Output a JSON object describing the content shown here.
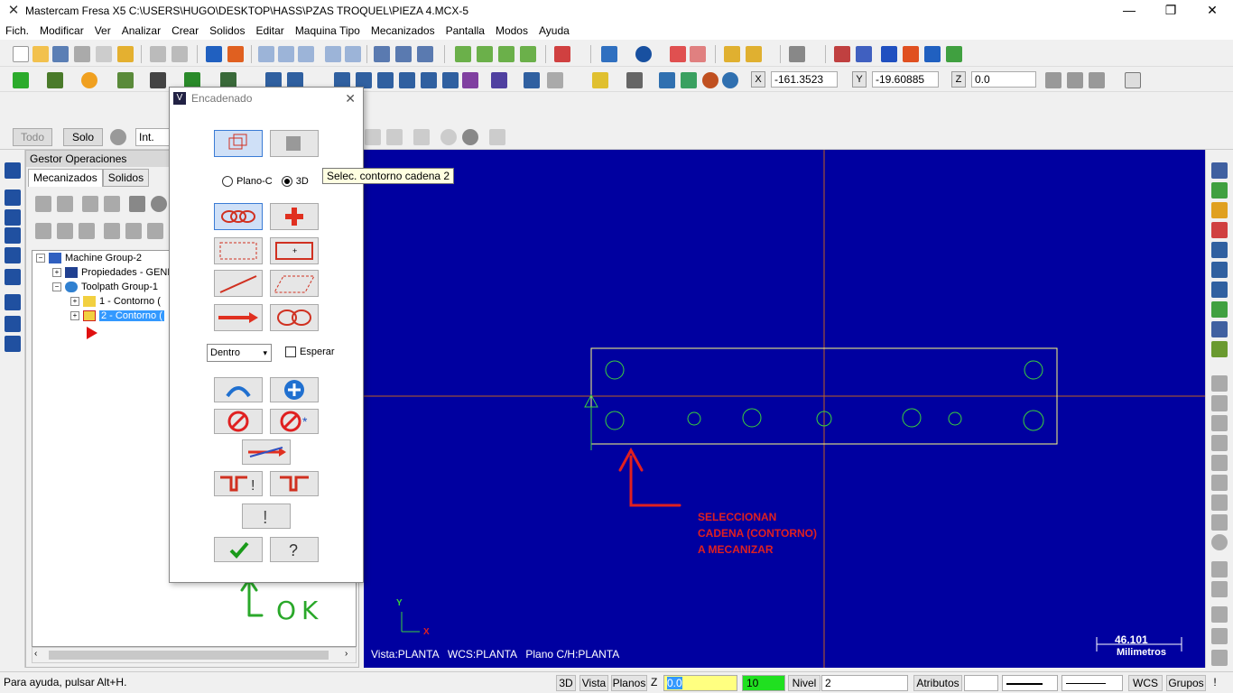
{
  "window": {
    "app_title": "Mastercam Fresa X5  C:\\USERS\\HUGO\\DESKTOP\\HASS\\PZAS TROQUEL\\PIEZA 4.MCX-5",
    "minimize": "—",
    "maximize": "❐",
    "close": "✕"
  },
  "menu": [
    "Fich.",
    "Modificar",
    "Ver",
    "Analizar",
    "Crear",
    "Solidos",
    "Editar",
    "Maquina Tipo",
    "Mecanizados",
    "Pantalla",
    "Modos",
    "Ayuda"
  ],
  "coords": {
    "x_label": "X",
    "x_value": "-161.3523",
    "y_label": "Y",
    "y_value": "-19.60885",
    "z_label": "Z",
    "z_value": "0.0"
  },
  "ribbon": {
    "todo": "Todo",
    "solo": "Solo",
    "int_value": "Int."
  },
  "ops_manager": {
    "title": "Gestor Operaciones",
    "tabs": [
      "Mecanizados",
      "Solidos"
    ],
    "tree": {
      "machine_group": "Machine Group-2",
      "properties": "Propiedades - GENE",
      "toolpath_group": "Toolpath Group-1",
      "op1": "1 - Contorno  (",
      "op2": "2 - Contorno  ("
    }
  },
  "dialog": {
    "title": "Encadenado",
    "radio_plane": "Plano-C",
    "radio_3d": "3D",
    "mode_select": "Dentro",
    "wait_label": "Esperar"
  },
  "tooltip": "Selec. contorno cadena 2",
  "viewport": {
    "annotation_lines": [
      "SELECCIONAN",
      "CADENA (CONTORNO)",
      "A MECANIZAR"
    ],
    "ok_annotation": "OK",
    "axis_y": "Y",
    "axis_x": "X",
    "status_view": "Vista:PLANTA   WCS:PLANTA   Plano C/H:PLANTA",
    "scale_value": "46.101",
    "scale_unit": "Milimetros"
  },
  "statusbar": {
    "help": "Para ayuda, pulsar Alt+H.",
    "b3d": "3D",
    "vista": "Vista",
    "planos": "Planos",
    "z_label": "Z",
    "z_value": "0.0",
    "color_value": "10",
    "nivel_label": "Nivel",
    "nivel_value": "2",
    "atributos": "Atributos",
    "wcs": "WCS",
    "grupos": "Grupos",
    "bang": "!"
  },
  "colors": {
    "viewport_bg": "#0000a0",
    "geometry": "#ffff80",
    "chain_green": "#3bd23b",
    "annotation_red": "#e02020",
    "crosshair": "#c06020"
  }
}
